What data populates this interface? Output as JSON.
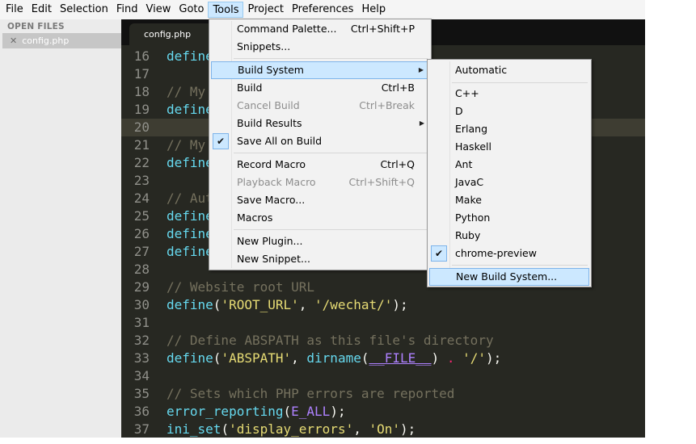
{
  "menubar": {
    "items": [
      "File",
      "Edit",
      "Selection",
      "Find",
      "View",
      "Goto",
      "Tools",
      "Project",
      "Preferences",
      "Help"
    ],
    "active": "Tools"
  },
  "sidebar": {
    "header": "OPEN FILES",
    "close_glyph": "✕",
    "file": "config.php"
  },
  "tab": {
    "title": "config.php"
  },
  "code": {
    "line_numbers": [
      "16",
      "17",
      "18",
      "19",
      "20",
      "21",
      "22",
      "23",
      "24",
      "25",
      "26",
      "27",
      "28",
      "29",
      "30",
      "31",
      "32",
      "33",
      "34",
      "35",
      "36",
      "37"
    ],
    "current_line": "20",
    "visible_fragments": {
      "l16": "define",
      "l18": "// My",
      "l19": "define",
      "l21": "// My",
      "l22": "define",
      "l24": "// Aut",
      "l25": "define",
      "l26": "define",
      "l27": "define",
      "l29": "// Website root URL",
      "l30": {
        "fn": "define",
        "p1": "(",
        "s1": "'ROOT_URL'",
        "p2": ", ",
        "s2": "'/wechat/'",
        "p3": ");"
      },
      "l32": "// Define ABSPATH as this file's directory",
      "l33": {
        "fn": "define",
        "p1": "(",
        "s1": "'ABSPATH'",
        "p2": ", ",
        "fn2": "dirname",
        "p3": "(",
        "c1": "__FILE__",
        "p4": ") ",
        "op": ".",
        "p5": " ",
        "s2": "'/'",
        "p6": ");"
      },
      "l35": "// Sets which PHP errors are reported",
      "l36": {
        "fn": "error_reporting",
        "p1": "(",
        "c1": "E_ALL",
        "p2": ");"
      },
      "l37": {
        "fn": "ini_set",
        "p1": "(",
        "s1": "'display_errors'",
        "p2": ", ",
        "s2": "'On'",
        "p3": ");"
      }
    }
  },
  "tools_menu": {
    "command_palette": {
      "label": "Command Palette...",
      "shortcut": "Ctrl+Shift+P"
    },
    "snippets": {
      "label": "Snippets..."
    },
    "build_system": {
      "label": "Build System",
      "arrow": "▶"
    },
    "build": {
      "label": "Build",
      "shortcut": "Ctrl+B"
    },
    "cancel_build": {
      "label": "Cancel Build",
      "shortcut": "Ctrl+Break"
    },
    "build_results": {
      "label": "Build Results",
      "arrow": "▶"
    },
    "save_all_on_build": {
      "label": "Save All on Build",
      "check": "✔"
    },
    "record_macro": {
      "label": "Record Macro",
      "shortcut": "Ctrl+Q"
    },
    "playback_macro": {
      "label": "Playback Macro",
      "shortcut": "Ctrl+Shift+Q"
    },
    "save_macro": {
      "label": "Save Macro..."
    },
    "macros": {
      "label": "Macros"
    },
    "new_plugin": {
      "label": "New Plugin..."
    },
    "new_snippet": {
      "label": "New Snippet..."
    }
  },
  "build_submenu": {
    "automatic": "Automatic",
    "systems": [
      "C++",
      "D",
      "Erlang",
      "Haskell",
      "Ant",
      "JavaC",
      "Make",
      "Python",
      "Ruby"
    ],
    "checked": {
      "label": "chrome-preview",
      "check": "✔"
    },
    "new_build_system": "New Build System..."
  },
  "colors": {
    "editor_bg": "#272822",
    "keyword": "#66d9ef",
    "string": "#e6db74",
    "comment": "#75715e",
    "constant": "#ae81ff",
    "menu_highlight": "#cce8ff"
  }
}
